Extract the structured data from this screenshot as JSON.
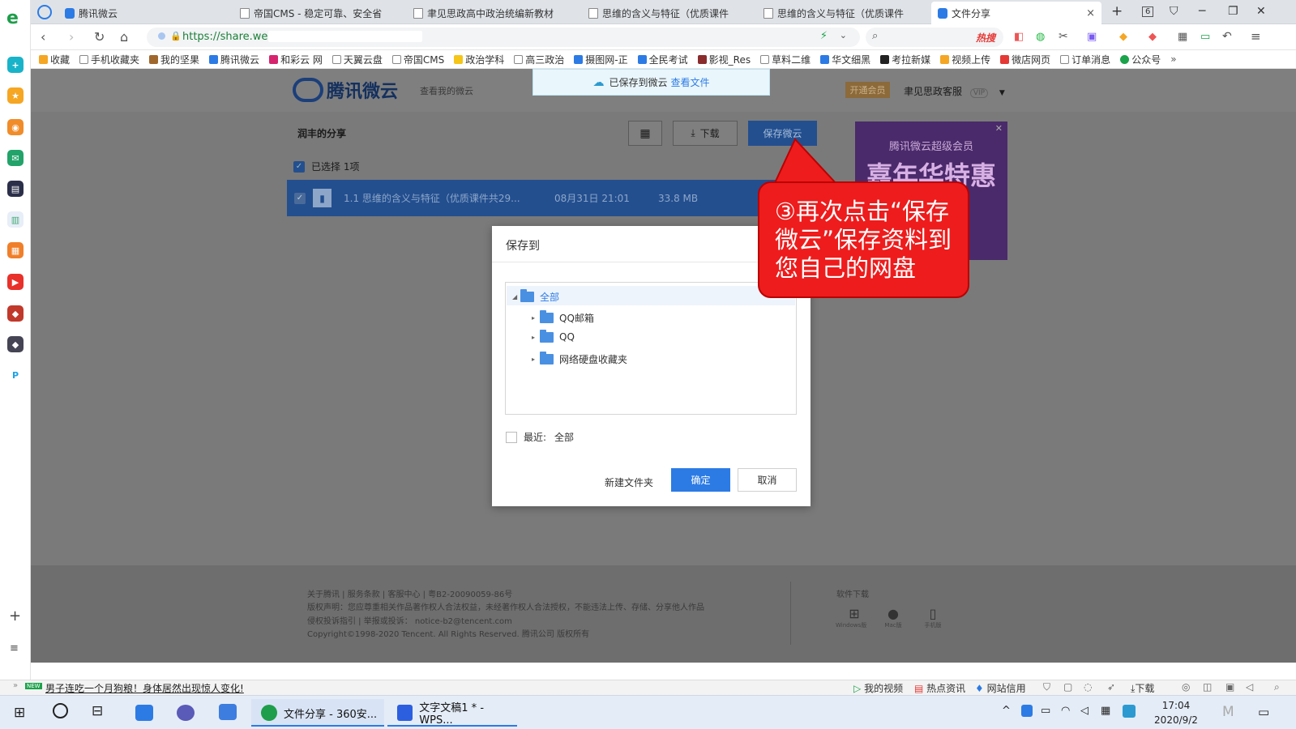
{
  "browser": {
    "tabs": [
      {
        "label": "腾讯微云",
        "icon": "weiyun-icon",
        "active": false
      },
      {
        "label": "帝国CMS - 稳定可靠、安全省",
        "icon": "page-icon",
        "active": false
      },
      {
        "label": "聿见思政高中政治统编新教材",
        "icon": "page-icon",
        "active": false
      },
      {
        "label": "思维的含义与特征（优质课件",
        "icon": "page-icon",
        "active": false
      },
      {
        "label": "思维的含义与特征（优质课件",
        "icon": "page-icon",
        "active": false
      },
      {
        "label": "文件分享",
        "icon": "weiyun-icon",
        "active": true
      }
    ],
    "tab_count": "6",
    "url": "https://share.weiyun.com/",
    "search_hot": "热搜",
    "bookmarks": [
      "收藏",
      "手机收藏夹",
      "我的坚果",
      "腾讯微云",
      "和彩云 网",
      "天翼云盘",
      "帝国CMS",
      "政治学科",
      "高三政治",
      "摄图网-正",
      "全民考试",
      "影视_Res",
      "草料二维",
      "华文细黑",
      "考拉新媒",
      "视频上传",
      "微店网页",
      "订单消息",
      "公众号"
    ]
  },
  "weiyun": {
    "logo_text": "腾讯微云",
    "view_my": "查看我的微云",
    "notice": "已保存到微云",
    "notice_link": "查看文件",
    "vip_button": "开通会员",
    "username": "聿见思政客服",
    "vip_badge": "VIP",
    "share_title": "润丰的分享",
    "download_label": "下载",
    "save_label": "保存微云",
    "selected_text": "已选择 1项",
    "file": {
      "name": "1.1 思维的含义与特征（优质课件共29...",
      "date": "08月31日 21:01",
      "size": "33.8 MB"
    },
    "ad": {
      "line1": "腾讯微云超级会员",
      "line2": "嘉年华特惠"
    }
  },
  "dialog": {
    "title": "保存到",
    "root": "全部",
    "folders": [
      "QQ邮箱",
      "QQ",
      "网络硬盘收藏夹"
    ],
    "recent_label": "最近:",
    "recent_value": "全部",
    "new_folder": "新建文件夹",
    "ok": "确定",
    "cancel": "取消"
  },
  "callout": {
    "text": "③再次点击“保存微云”保存资料到您自己的网盘"
  },
  "footer": {
    "line1": "关于腾讯 | 服务条款 | 客服中心 | 粤B2-20090059-86号",
    "line2": "版权声明：您应尊重相关作品著作权人合法权益，未经著作权人合法授权，不能违法上传、存储、分享他人作品",
    "line3": "侵权投诉指引 | 举报或投诉： notice-b2@tencent.com",
    "line4": "Copyright©1998-2020 Tencent. All Rights Reserved. 腾讯公司 版权所有",
    "download_title": "软件下载",
    "platforms": [
      "Windows版",
      "Mac版",
      "手机版"
    ]
  },
  "statusbar": {
    "news": "男子连吃一个月狗粮！身体居然出现惊人变化!",
    "items": [
      "我的视频",
      "热点资讯",
      "网站信用",
      "下载"
    ]
  },
  "taskbar": {
    "apps": [
      "文件分享 - 360安...",
      "文字文稿1 * - WPS..."
    ],
    "time": "17:04",
    "date": "2020/9/2"
  },
  "colors": {
    "accent": "#2c7be5",
    "callout": "#ee1c1c",
    "overlay_page": "#7a7a7a"
  }
}
